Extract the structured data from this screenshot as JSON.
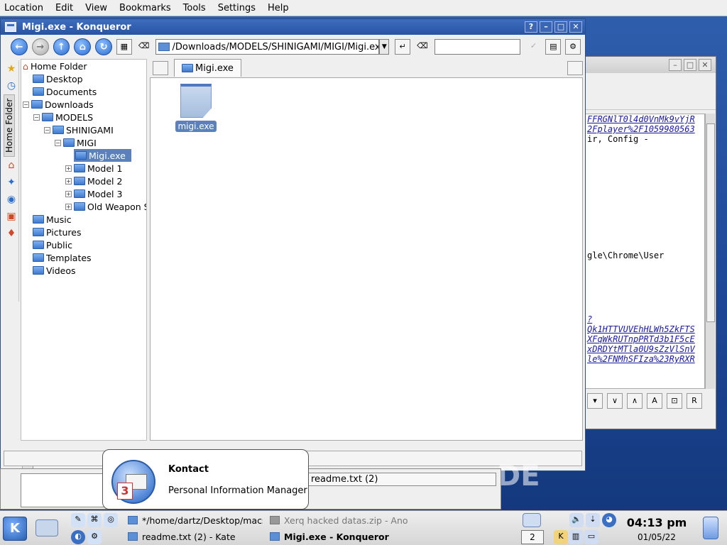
{
  "menubar": {
    "items": [
      "Location",
      "Edit",
      "View",
      "Bookmarks",
      "Tools",
      "Settings",
      "Help"
    ]
  },
  "konqueror": {
    "title": "Migi.exe - Konqueror",
    "url": "/Downloads/MODELS/SHINIGAMI/MIGI/Migi.exe",
    "tab_label": "Migi.exe",
    "sidebar_tab_label": "Home Folder",
    "file_label": "migi.exe",
    "tree": [
      {
        "label": "Home Folder"
      },
      {
        "label": "Desktop"
      },
      {
        "label": "Documents"
      },
      {
        "label": "Downloads"
      },
      {
        "label": "MODELS"
      },
      {
        "label": "SHINIGAMI"
      },
      {
        "label": "MIGI"
      },
      {
        "label": "Migi.exe"
      },
      {
        "label": "Model 1"
      },
      {
        "label": "Model 2"
      },
      {
        "label": "Model 3"
      },
      {
        "label": "Old Weapon S"
      },
      {
        "label": "Music"
      },
      {
        "label": "Pictures"
      },
      {
        "label": "Public"
      },
      {
        "label": "Templates"
      },
      {
        "label": "Videos"
      }
    ]
  },
  "bg_editor": {
    "lines": [
      "FFRGNlT0l4d0VnMk9vYjR",
      "2Fplayer%2F1059980563",
      "ir, Config -",
      "gle\\Chrome\\User",
      "?",
      "Qk1HTTVUVEhHLWh5ZkFTS",
      "XFqWkRUTnpPRTd3b1F5cE",
      "xDRDYtMTla0U9sZzVlSnV",
      "le%2FNMhSFIza%23RyRXR"
    ]
  },
  "lower_window": {
    "field_text": "readme.txt (2)"
  },
  "notification": {
    "title": "Kontact",
    "body": "Personal Information Manager",
    "badge": "3"
  },
  "taskbar": {
    "tasks": [
      "*/home/dartz/Desktop/macsk",
      "Xerq hacked datas.zip - Ano",
      "readme.txt (2) - Kate",
      "Migi.exe - Konqueror"
    ],
    "desktop_number": "2",
    "time": "04:13 pm",
    "date": "01/05/22"
  }
}
